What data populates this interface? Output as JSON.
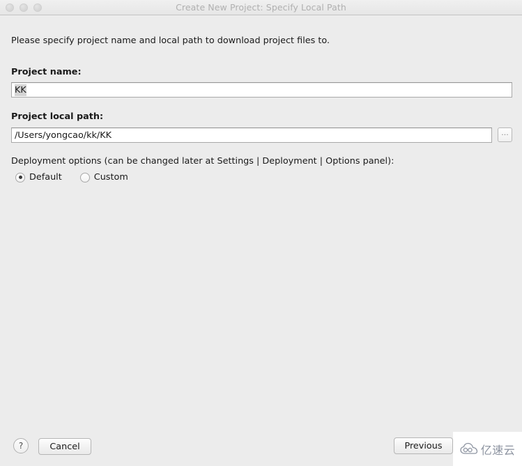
{
  "window": {
    "title": "Create New Project: Specify Local Path",
    "traffic_lights": [
      "close",
      "minimize",
      "maximize"
    ]
  },
  "content": {
    "instruction": "Please specify project name and local path to download project files to.",
    "project_name": {
      "label": "Project name:",
      "value": "KK",
      "selected": true
    },
    "project_local_path": {
      "label": "Project local path:",
      "value": "/Users/yongcao/kk/KK",
      "browse_label": "..."
    },
    "deployment": {
      "label": "Deployment options (can be changed later at Settings | Deployment | Options panel):",
      "options": [
        {
          "label": "Default",
          "checked": true
        },
        {
          "label": "Custom",
          "checked": false
        }
      ]
    }
  },
  "footer": {
    "help_label": "?",
    "cancel_label": "Cancel",
    "previous_label": "Previous"
  },
  "watermark": {
    "text": "亿速云",
    "icon": "cloud-icon"
  },
  "colors": {
    "background": "#ececec",
    "titlebar": "#eeeeee",
    "title_text": "#b0b0b0",
    "text": "#1a1a1a",
    "input_background": "#ffffff",
    "input_border": "#a9a9a9",
    "selection": "#d4d4d4",
    "watermark_text": "#8c93a0"
  }
}
